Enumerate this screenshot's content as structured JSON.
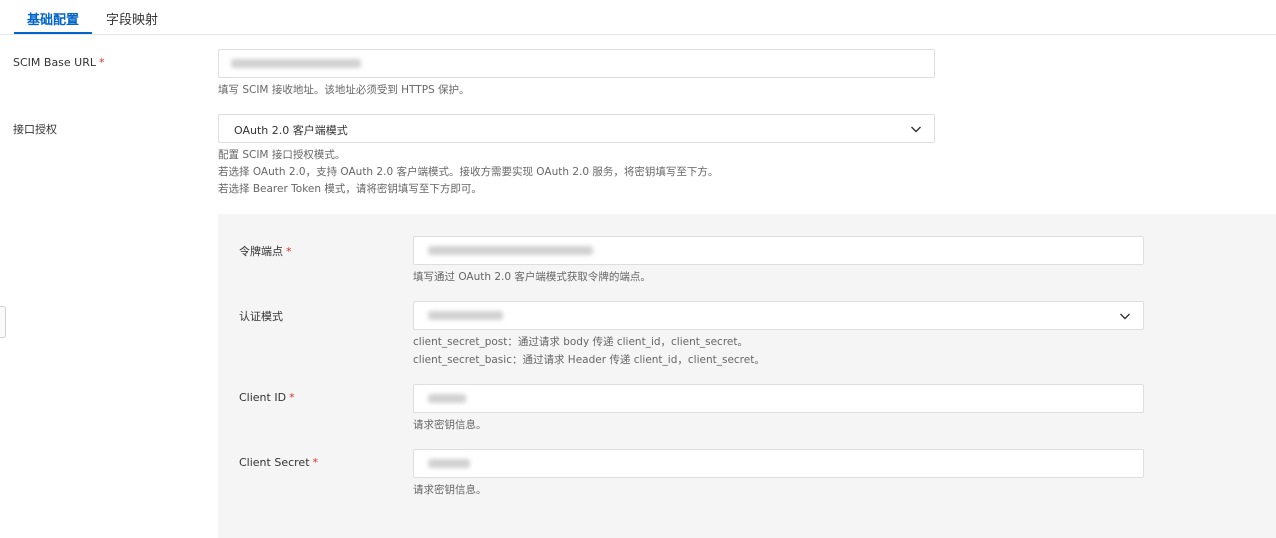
{
  "tabs": [
    {
      "label": "基础配置",
      "active": true
    },
    {
      "label": "字段映射",
      "active": false
    }
  ],
  "fields": {
    "base_url": {
      "label": "SCIM Base URL",
      "required_mark": "*",
      "help": "填写 SCIM 接收地址。该地址必须受到 HTTPS 保护。"
    },
    "auth": {
      "label": "接口授权",
      "value": "OAuth 2.0 客户端模式",
      "help_lines": [
        "配置 SCIM 接口授权模式。",
        "若选择 OAuth 2.0，支持 OAuth 2.0 客户端模式。接收方需要实现 OAuth 2.0 服务，将密钥填写至下方。",
        "若选择 Bearer Token 模式，请将密钥填写至下方即可。"
      ]
    },
    "token_endpoint": {
      "label": "令牌端点",
      "required_mark": "*",
      "help": "填写通过 OAuth 2.0 客户端模式获取令牌的端点。"
    },
    "auth_mode": {
      "label": "认证模式",
      "help_lines": [
        "client_secret_post：通过请求 body 传递 client_id，client_secret。",
        "client_secret_basic：通过请求 Header 传递 client_id，client_secret。"
      ]
    },
    "client_id": {
      "label": "Client ID",
      "required_mark": "*",
      "help": "请求密钥信息。"
    },
    "client_secret": {
      "label": "Client Secret",
      "required_mark": "*",
      "help": "请求密钥信息。"
    }
  },
  "icons": {
    "dropdown": "chevron-down-icon"
  },
  "colors": {
    "accent": "#0064c8",
    "required": "#d93026",
    "panel_bg": "#f5f5f5",
    "border": "#dedede"
  }
}
